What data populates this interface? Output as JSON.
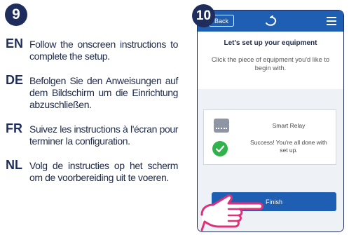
{
  "steps": {
    "left_number": "9",
    "right_number": "10"
  },
  "instructions": [
    {
      "code": "EN",
      "text": "Follow the onscreen instructions to complete the setup."
    },
    {
      "code": "DE",
      "text": "Befolgen Sie den Anweisungen auf dem Bildschirm um die Einrichtung abzuschließen."
    },
    {
      "code": "FR",
      "text": "Suivez les instructions à l'écran pour terminer la configuration."
    },
    {
      "code": "NL",
      "text": "Volg de instructies op het scherm om de voorbereiding uit te voeren."
    }
  ],
  "phone": {
    "back_label": "Back",
    "title": "Let's set up your equipment",
    "subtitle": "Click the piece of equipment you'd like to begin with.",
    "device_name": "Smart Relay",
    "success_message": "Success! You're all done with set up.",
    "finish_label": "Finish"
  },
  "icons": {
    "logo": "brand-logo-icon",
    "menu": "hamburger-menu-icon",
    "device": "smart-relay-icon",
    "success": "check-circle-icon",
    "pointer": "pointing-hand-icon"
  },
  "colors": {
    "navy": "#1f2d5c",
    "app_blue": "#1f5fb3",
    "success_green": "#2fb34a",
    "hand_pink": "#e0307a"
  }
}
